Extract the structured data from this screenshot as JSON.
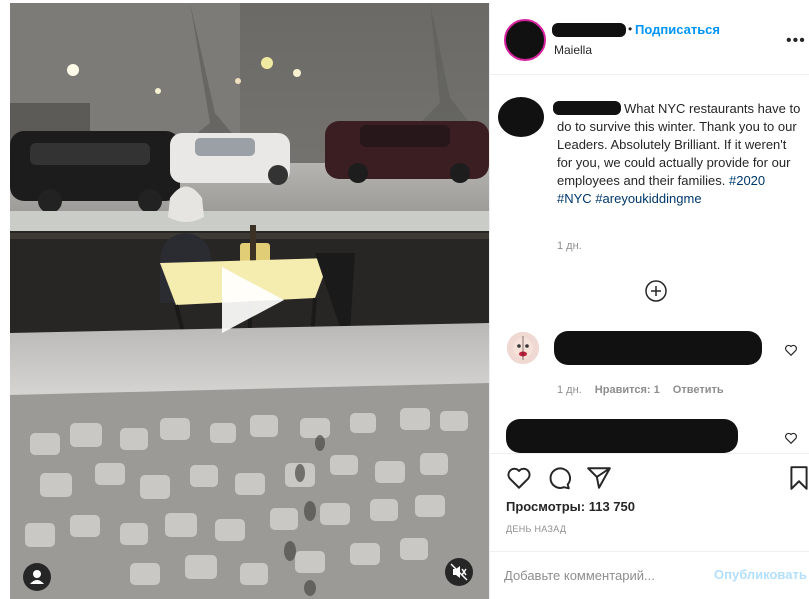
{
  "post": {
    "header": {
      "follow_label": "Подписаться",
      "location": "Maiella",
      "more_icon": "more-horizontal-icon"
    },
    "caption": {
      "text": "What NYC restaurants have to do to survive this winter. Thank you to our Leaders. Absolutely Brilliant. If it weren't for you, we could actually provide for our employees and their families.",
      "hashtags": [
        "#2020",
        "#NYC",
        "#areyoukiddingme"
      ],
      "time": "1 дн."
    },
    "comments": [
      {
        "time": "1 дн.",
        "likes": "Нравится: 1",
        "reply": "Ответить"
      }
    ],
    "views_label": "Просмотры:",
    "views_count": "113 750",
    "date": "ДЕНЬ НАЗАД",
    "comment_input": {
      "placeholder": "Добавьте комментарий..."
    },
    "publish_label": "Опубликовать"
  },
  "colors": {
    "link_blue": "#0095f6",
    "hashtag": "#00376b",
    "muted": "#8e8e8e",
    "publish_disabled": "#b2dffc"
  }
}
